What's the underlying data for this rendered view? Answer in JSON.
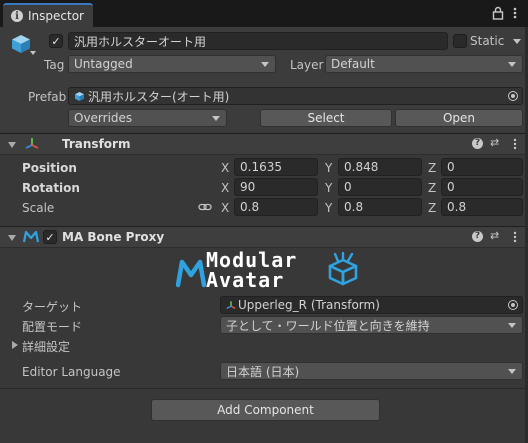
{
  "window": {
    "tab_title": "Inspector"
  },
  "gameobject": {
    "name": "汎用ホルスターオート用",
    "static_label": "Static",
    "tag_label": "Tag",
    "tag_value": "Untagged",
    "layer_label": "Layer",
    "layer_value": "Default",
    "prefab_label": "Prefab",
    "prefab_value": "汎用ホルスター(オート用)",
    "overrides_label": "Overrides",
    "select_label": "Select",
    "open_label": "Open"
  },
  "transform": {
    "title": "Transform",
    "position_label": "Position",
    "rotation_label": "Rotation",
    "scale_label": "Scale",
    "axis_x": "X",
    "axis_y": "Y",
    "axis_z": "Z",
    "position": {
      "x": "0.1635",
      "y": "0.848",
      "z": "0"
    },
    "rotation": {
      "x": "90",
      "y": "0",
      "z": "0"
    },
    "scale": {
      "x": "0.8",
      "y": "0.8",
      "z": "0.8"
    }
  },
  "bone_proxy": {
    "title": "MA Bone Proxy",
    "logo_line1": "Modular",
    "logo_line2": "Avatar",
    "target_label": "ターゲット",
    "target_value": "Upperleg_R (Transform)",
    "mode_label": "配置モード",
    "mode_value": "子として・ワールド位置と向きを維持",
    "advanced_label": "詳細設定",
    "language_label": "Editor Language",
    "language_value": "日本語 (日本)"
  },
  "footer": {
    "add_component_label": "Add Component"
  },
  "colors": {
    "accent_blue": "#3a79bb",
    "logo_blue": "#2fa3e0",
    "background": "#383838"
  }
}
